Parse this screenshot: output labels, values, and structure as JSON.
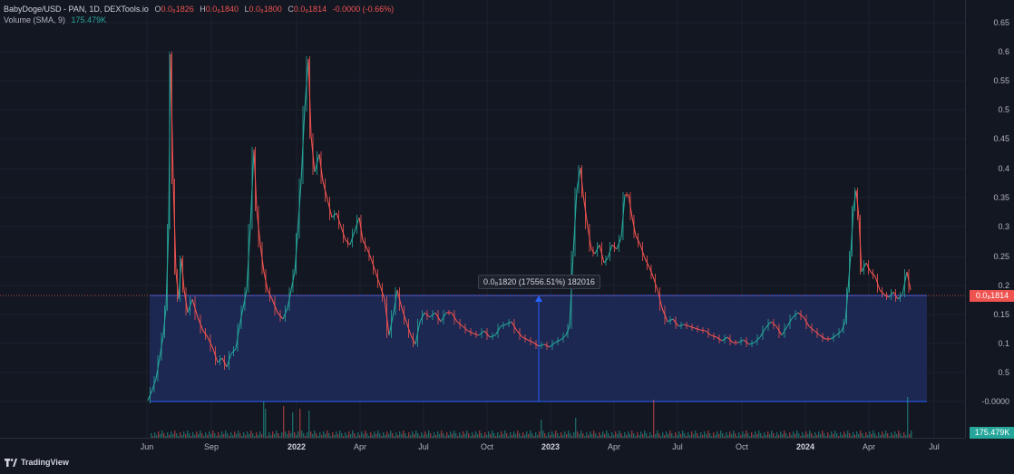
{
  "symbol": {
    "pair": "BabyDoge/USD",
    "meta": " - PAN, 1D, DEXTools.io",
    "open_label": "O",
    "open_value": "0.0₈1826",
    "high_label": "H",
    "high_value": "0.0₈1840",
    "low_label": "L",
    "low_value": "0.0₈1800",
    "close_label": "C",
    "close_value": "0.0₈1814",
    "change": "-0.0000 (-0.66%)"
  },
  "volume_legend": {
    "label": "Volume (SMA, 9)",
    "value": "175.479K"
  },
  "price_axis": [
    "0.65",
    "0.6",
    "0.55",
    "0.5",
    "0.45",
    "0.4",
    "0.35",
    "0.3",
    "0.25",
    "0.2",
    "0.15",
    "0.1",
    "0.5",
    "-0.0000"
  ],
  "current_price_badge": "0.0₈1814",
  "volume_badge": "175.479K",
  "time_axis": [
    {
      "label": "Jun",
      "bold": false
    },
    {
      "label": "Sep",
      "bold": false
    },
    {
      "label": "2022",
      "bold": true
    },
    {
      "label": "Apr",
      "bold": false
    },
    {
      "label": "Jul",
      "bold": false
    },
    {
      "label": "Oct",
      "bold": false
    },
    {
      "label": "2023",
      "bold": true
    },
    {
      "label": "Apr",
      "bold": false
    },
    {
      "label": "Jul",
      "bold": false
    },
    {
      "label": "Oct",
      "bold": false
    },
    {
      "label": "2024",
      "bold": true
    },
    {
      "label": "Apr",
      "bold": false
    },
    {
      "label": "Jul",
      "bold": false
    }
  ],
  "measure_tool_label": "0.0₈1820 (17556.51%) 182016",
  "branding": "TradingView",
  "colors": {
    "up": "#26a69a",
    "down": "#ef5350",
    "measure_fill": "#1e2a5a",
    "measure_line": "#2962ff",
    "background": "#131722"
  }
}
